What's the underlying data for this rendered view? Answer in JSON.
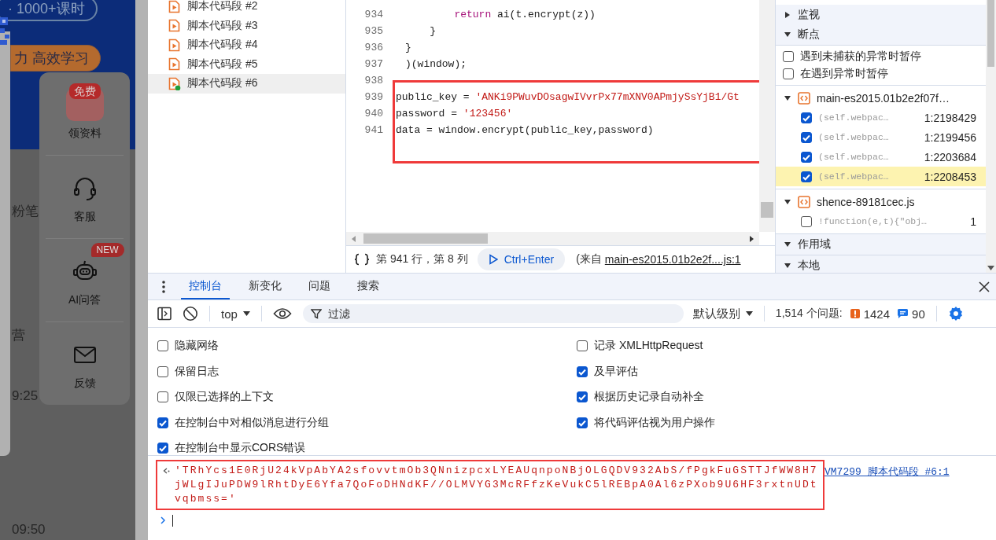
{
  "web_page": {
    "banner_pills": [
      {
        "kind": "outline",
        "text": "· 1000+课时"
      },
      {
        "kind": "orange",
        "text": "力 高效学习"
      }
    ],
    "fragments": [
      {
        "text": "粉笔"
      },
      {
        "text": "营"
      },
      {
        "text": "9:25"
      },
      {
        "text": "09:50"
      }
    ],
    "widget_items": [
      {
        "kind": "gift",
        "icon_text": "免费",
        "label": "领资料"
      },
      {
        "kind": "headset",
        "label": "客服"
      },
      {
        "kind": "robot",
        "label": "AI问答",
        "badge": "NEW"
      },
      {
        "kind": "mail",
        "label": "反馈"
      }
    ]
  },
  "navigator": {
    "items": [
      {
        "label": "脚本代码段 #2",
        "selected": false,
        "running": false
      },
      {
        "label": "脚本代码段 #3",
        "selected": false,
        "running": false
      },
      {
        "label": "脚本代码段 #4",
        "selected": false,
        "running": false
      },
      {
        "label": "脚本代码段 #5",
        "selected": false,
        "running": false
      },
      {
        "label": "脚本代码段 #6",
        "selected": true,
        "running": true
      }
    ]
  },
  "editor": {
    "lines": [
      {
        "number": "934",
        "highlighted": false,
        "tokens": [
          {
            "kind": "keyword",
            "text": "        return"
          },
          {
            "kind": "plain",
            "text": " ai(t.encrypt(z))"
          }
        ]
      },
      {
        "number": "935",
        "highlighted": false,
        "tokens": [
          {
            "kind": "plain",
            "text": "    }"
          }
        ]
      },
      {
        "number": "936",
        "highlighted": false,
        "tokens": [
          {
            "kind": "plain",
            "text": "}"
          }
        ]
      },
      {
        "number": "937",
        "highlighted": false,
        "tokens": [
          {
            "kind": "plain",
            "text": ")(window);"
          }
        ]
      },
      {
        "number": "938",
        "highlighted": false
      },
      {
        "number": "939",
        "highlighted": true,
        "tokens": [
          {
            "kind": "plain",
            "text": "public_key = "
          },
          {
            "kind": "string",
            "text": "'ANKi9PWuvDOsagwIVvrPx77mXNV0APmjySsYjB1/Gt"
          }
        ]
      },
      {
        "number": "940",
        "highlighted": true,
        "tokens": [
          {
            "kind": "plain",
            "text": "password = "
          },
          {
            "kind": "string",
            "text": "'123456'"
          }
        ]
      },
      {
        "number": "941",
        "highlighted": true,
        "tokens": [
          {
            "kind": "plain",
            "text": "data = window.encrypt(public_key,password)"
          }
        ]
      }
    ],
    "status": {
      "position": "第 941 行，第 8 列",
      "run_button": "Ctrl+Enter",
      "source_prefix": "(来自",
      "source_link": "main-es2015.01b2e2f....js:1"
    }
  },
  "debugger_sidebar": {
    "sections": [
      {
        "title": "监视",
        "expanded": false
      },
      {
        "title": "断点",
        "expanded": true,
        "options": [
          {
            "label": "遇到未捕获的异常时暂停",
            "checked": false
          },
          {
            "label": "在遇到异常时暂停",
            "checked": false
          }
        ],
        "files": [
          {
            "name": "main-es2015.01b2e2f07f…",
            "expanded": true,
            "breakpoints": [
              {
                "code": "(self.webpac…",
                "location": "1:2198429",
                "checked": true,
                "selected": false
              },
              {
                "code": "(self.webpac…",
                "location": "1:2199456",
                "checked": true,
                "selected": false
              },
              {
                "code": "(self.webpac…",
                "location": "1:2203684",
                "checked": true,
                "selected": false
              },
              {
                "code": "(self.webpac…",
                "location": "1:2208453",
                "checked": true,
                "selected": true
              }
            ]
          },
          {
            "name": "shence-89181cec.js",
            "expanded": true,
            "breakpoints": [
              {
                "code": "!function(e,t){\"obj…",
                "location": "1",
                "checked": false,
                "selected": false
              }
            ]
          }
        ]
      },
      {
        "title": "作用域",
        "expanded": true,
        "subsections": [
          {
            "title": "本地",
            "expanded": true
          }
        ]
      }
    ]
  },
  "console": {
    "tabs": [
      {
        "label": "控制台",
        "selected": true
      },
      {
        "label": "新变化",
        "selected": false
      },
      {
        "label": "问题",
        "selected": false
      },
      {
        "label": "搜索",
        "selected": false
      }
    ],
    "toolbar": {
      "context": "top",
      "filter_placeholder": "过滤",
      "level": "默认级别",
      "issues_label": "1,514 个问题:",
      "issue_counts": [
        {
          "kind": "error",
          "count": "1424"
        },
        {
          "kind": "info",
          "count": "90"
        }
      ]
    },
    "settings": {
      "left": [
        {
          "label": "隐藏网络",
          "checked": false
        },
        {
          "label": "保留日志",
          "checked": false
        },
        {
          "label": "仅限已选择的上下文",
          "checked": false
        },
        {
          "label": "在控制台中对相似消息进行分组",
          "checked": true
        },
        {
          "label": "在控制台中显示CORS错误",
          "checked": true
        }
      ],
      "right": [
        {
          "label": "记录 XMLHttpRequest",
          "checked": false
        },
        {
          "label": "及早评估",
          "checked": true
        },
        {
          "label": "根据历史记录自动补全",
          "checked": true
        },
        {
          "label": "将代码评估视为用户操作",
          "checked": true
        }
      ]
    },
    "output": [
      {
        "kind": "result",
        "text": "'TRhYcs1E0RjU24kVpAbYA2sfovvtmOb3QNnizpcxLYEAUqnpoNBjOLGQDV932AbS/fPgkFuGSTTJfWW8H7jWLgIJuPDW9lRhtDyE6Yfa7QoFoDHNdKF//OLMVYG3McRFfzKeVukC5lREBpA0Al6zPXob9U6HF3rxtnUDtvqbmss='",
        "source": "VM7299 脚本代码段 #6:1",
        "highlighted": true
      }
    ]
  }
}
